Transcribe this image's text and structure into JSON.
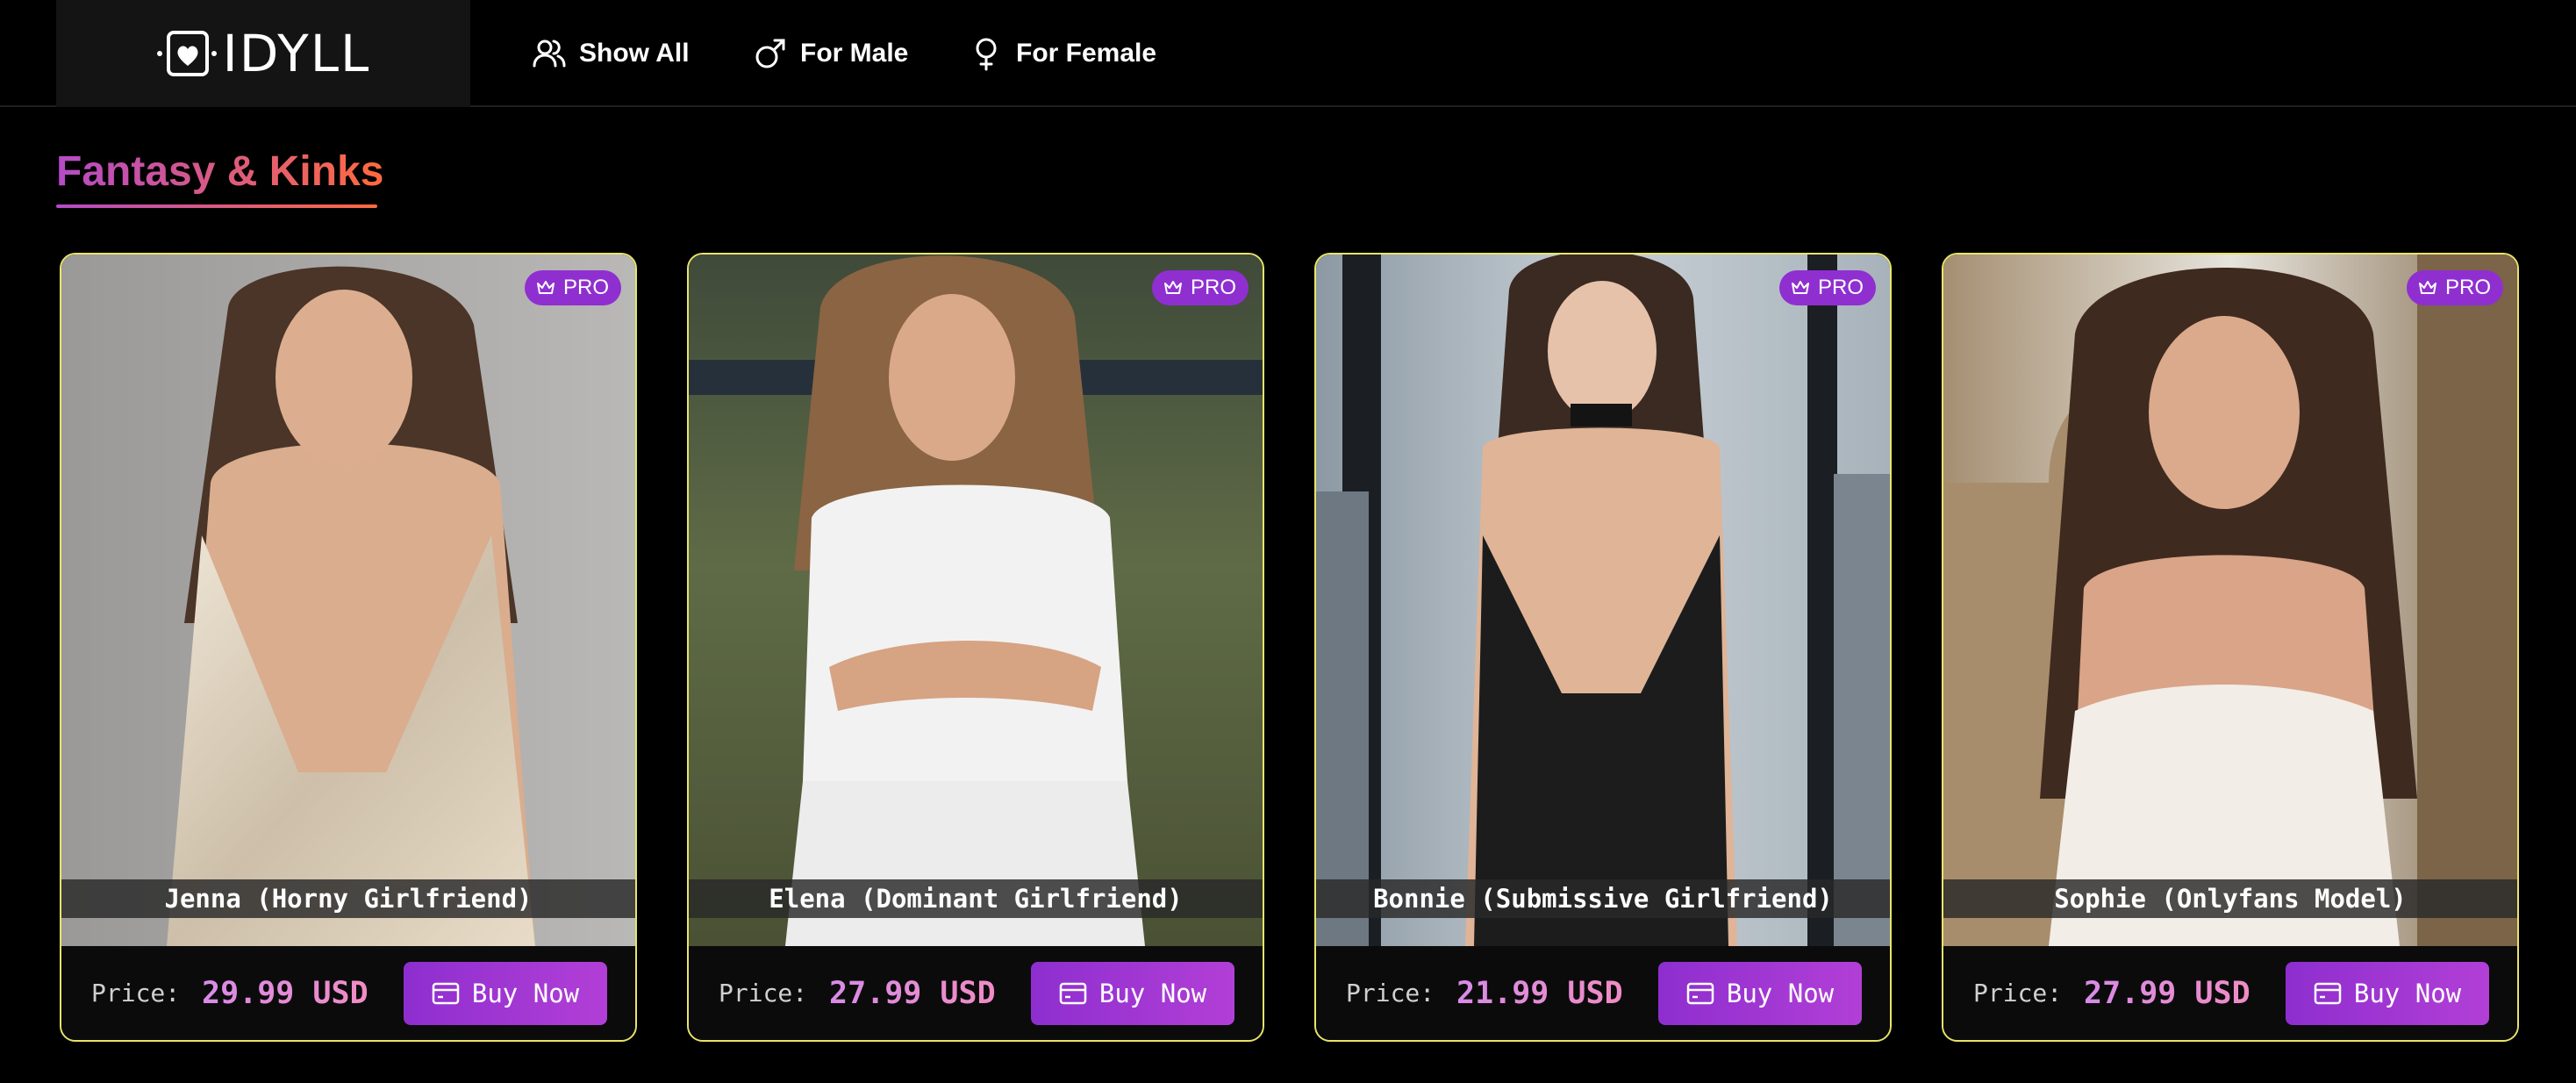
{
  "header": {
    "logo_text": "IDYLL",
    "nav": [
      {
        "label": "Show All",
        "icon": "users-icon"
      },
      {
        "label": "For Male",
        "icon": "male-icon"
      },
      {
        "label": "For Female",
        "icon": "female-icon"
      }
    ]
  },
  "section": {
    "title": "Fantasy & Kinks"
  },
  "cards": [
    {
      "name": "Jenna (Horny Girlfriend)",
      "badge": "PRO",
      "price_label": "Price:",
      "price": "29.99 USD",
      "button": "Buy Now"
    },
    {
      "name": "Elena (Dominant Girlfriend)",
      "badge": "PRO",
      "price_label": "Price:",
      "price": "27.99 USD",
      "button": "Buy Now"
    },
    {
      "name": "Bonnie (Submissive Girlfriend)",
      "badge": "PRO",
      "price_label": "Price:",
      "price": "21.99 USD",
      "button": "Buy Now"
    },
    {
      "name": "Sophie (Onlyfans Model)",
      "badge": "PRO",
      "price_label": "Price:",
      "price": "27.99 USD",
      "button": "Buy Now"
    }
  ],
  "colors": {
    "background": "#000000",
    "card_border": "#e9e46a",
    "accent_purple": "#8e2ecf",
    "title_gradient_start": "#b44bc8",
    "title_gradient_end": "#ff6a3d"
  }
}
